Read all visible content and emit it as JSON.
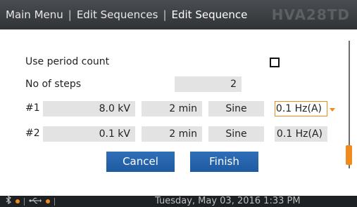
{
  "header": {
    "breadcrumbs": [
      "Main Menu",
      "Edit Sequences",
      "Edit Sequence"
    ],
    "separator": "|",
    "model": "HVA28TD"
  },
  "form": {
    "use_period_count_label": "Use period count",
    "use_period_count_checked": false,
    "no_of_steps_label": "No of steps",
    "no_of_steps_value": "2",
    "steps": [
      {
        "label": "#1",
        "voltage": "8.0 kV",
        "duration": "2 min",
        "waveform": "Sine",
        "frequency": "0.1 Hz(A)"
      },
      {
        "label": "#2",
        "voltage": "0.1 kV",
        "duration": "2 min",
        "waveform": "Sine",
        "frequency": "0.1 Hz(A)"
      }
    ]
  },
  "buttons": {
    "cancel": "Cancel",
    "finish": "Finish"
  },
  "status": {
    "datetime": "Tuesday, May 03, 2016 1:33 PM",
    "icons": [
      "bluetooth-icon",
      "usb-icon"
    ]
  },
  "colors": {
    "accent": "#f08a1c",
    "button": "#1f5aa0",
    "header": "#3a3e41",
    "field": "#e3e3e3"
  }
}
